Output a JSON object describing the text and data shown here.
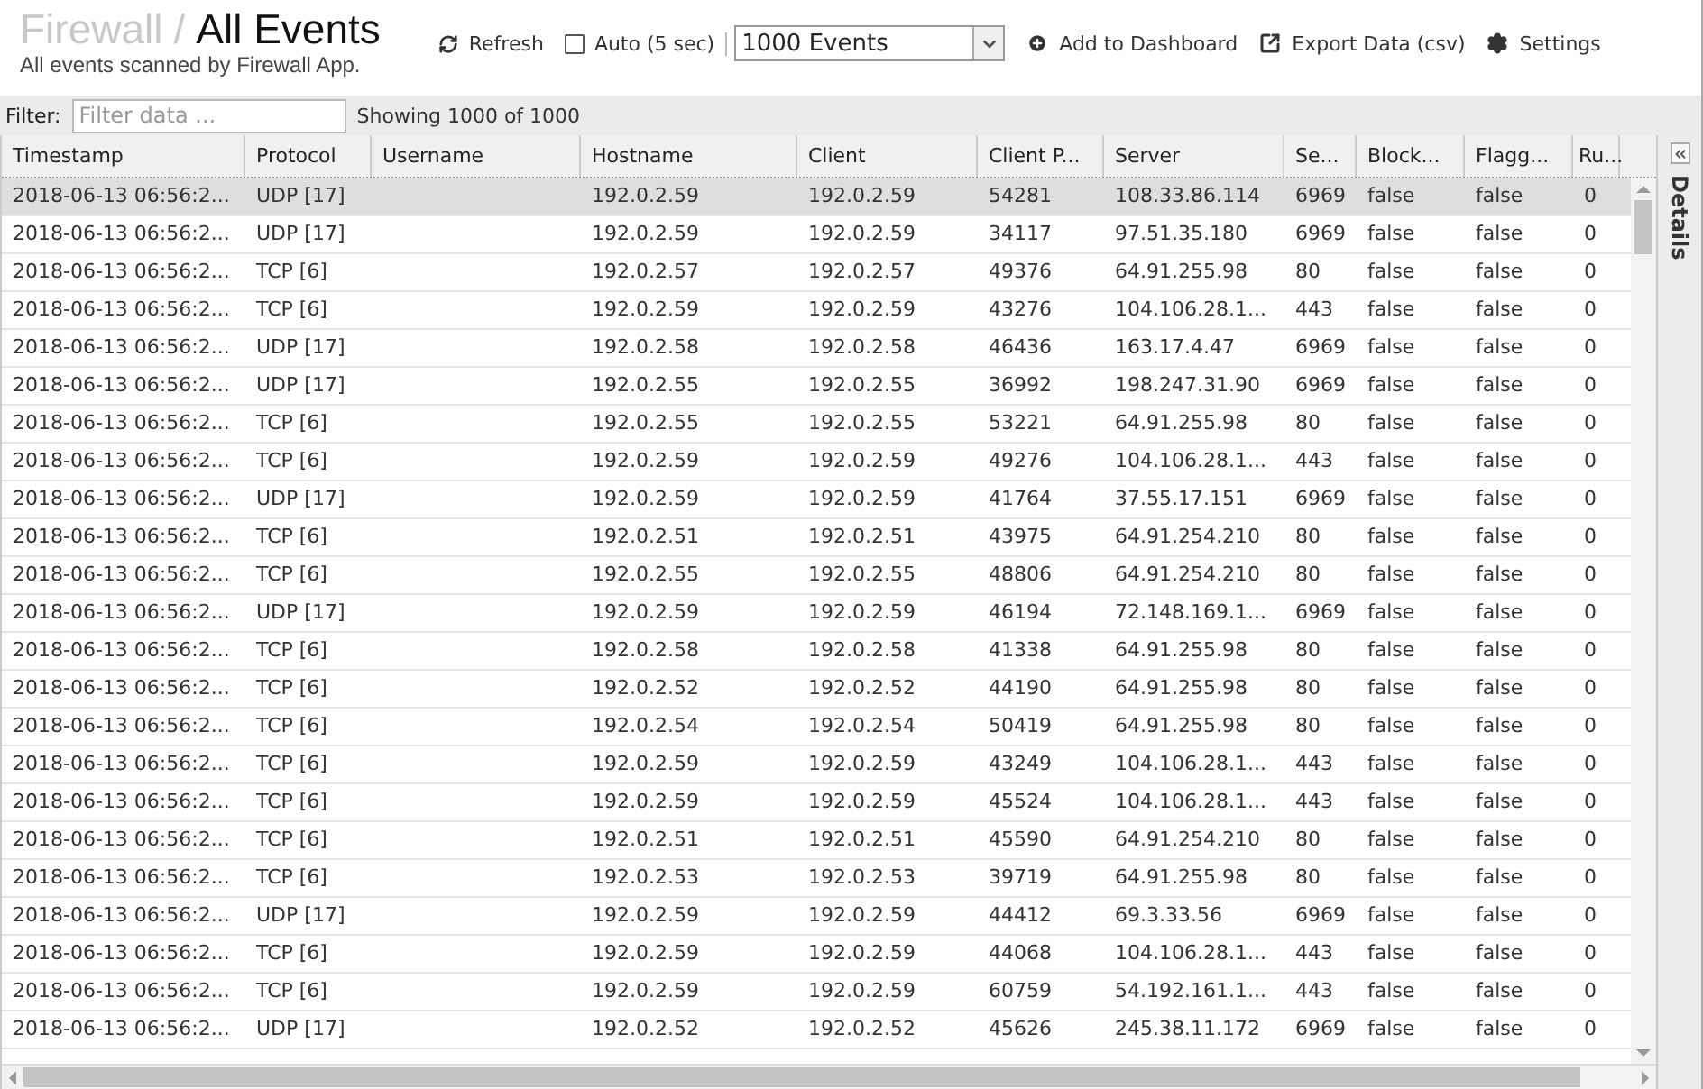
{
  "header": {
    "breadcrumb": "Firewall",
    "separator": "/",
    "title": "All Events",
    "subtitle": "All events scanned by Firewall App."
  },
  "toolbar": {
    "refresh": "Refresh",
    "auto": {
      "label": "Auto (5 sec)",
      "checked": false
    },
    "limit": "1000 Events",
    "add": "Add to Dashboard",
    "export": "Export Data (csv)",
    "settings": "Settings"
  },
  "filter": {
    "label": "Filter:",
    "placeholder": "Filter data ...",
    "count": "Showing 1000 of 1000"
  },
  "table": {
    "columns": [
      "Timestamp",
      "Protocol",
      "Username",
      "Hostname",
      "Client",
      "Client P...",
      "Server",
      "Se...",
      "Block...",
      "Flagg...",
      "Ru..."
    ],
    "rows": [
      {
        "selected": true,
        "cells": [
          "2018-06-13 06:56:2...",
          "UDP [17]",
          "",
          "192.0.2.59",
          "192.0.2.59",
          "54281",
          "108.33.86.114",
          "6969",
          "false",
          "false",
          "0"
        ]
      },
      {
        "selected": false,
        "cells": [
          "2018-06-13 06:56:2...",
          "UDP [17]",
          "",
          "192.0.2.59",
          "192.0.2.59",
          "34117",
          "97.51.35.180",
          "6969",
          "false",
          "false",
          "0"
        ]
      },
      {
        "selected": false,
        "cells": [
          "2018-06-13 06:56:2...",
          "TCP [6]",
          "",
          "192.0.2.57",
          "192.0.2.57",
          "49376",
          "64.91.255.98",
          "80",
          "false",
          "false",
          "0"
        ]
      },
      {
        "selected": false,
        "cells": [
          "2018-06-13 06:56:2...",
          "TCP [6]",
          "",
          "192.0.2.59",
          "192.0.2.59",
          "43276",
          "104.106.28.1...",
          "443",
          "false",
          "false",
          "0"
        ]
      },
      {
        "selected": false,
        "cells": [
          "2018-06-13 06:56:2...",
          "UDP [17]",
          "",
          "192.0.2.58",
          "192.0.2.58",
          "46436",
          "163.17.4.47",
          "6969",
          "false",
          "false",
          "0"
        ]
      },
      {
        "selected": false,
        "cells": [
          "2018-06-13 06:56:2...",
          "UDP [17]",
          "",
          "192.0.2.55",
          "192.0.2.55",
          "36992",
          "198.247.31.90",
          "6969",
          "false",
          "false",
          "0"
        ]
      },
      {
        "selected": false,
        "cells": [
          "2018-06-13 06:56:2...",
          "TCP [6]",
          "",
          "192.0.2.55",
          "192.0.2.55",
          "53221",
          "64.91.255.98",
          "80",
          "false",
          "false",
          "0"
        ]
      },
      {
        "selected": false,
        "cells": [
          "2018-06-13 06:56:2...",
          "TCP [6]",
          "",
          "192.0.2.59",
          "192.0.2.59",
          "49276",
          "104.106.28.1...",
          "443",
          "false",
          "false",
          "0"
        ]
      },
      {
        "selected": false,
        "cells": [
          "2018-06-13 06:56:2...",
          "UDP [17]",
          "",
          "192.0.2.59",
          "192.0.2.59",
          "41764",
          "37.55.17.151",
          "6969",
          "false",
          "false",
          "0"
        ]
      },
      {
        "selected": false,
        "cells": [
          "2018-06-13 06:56:2...",
          "TCP [6]",
          "",
          "192.0.2.51",
          "192.0.2.51",
          "43975",
          "64.91.254.210",
          "80",
          "false",
          "false",
          "0"
        ]
      },
      {
        "selected": false,
        "cells": [
          "2018-06-13 06:56:2...",
          "TCP [6]",
          "",
          "192.0.2.55",
          "192.0.2.55",
          "48806",
          "64.91.254.210",
          "80",
          "false",
          "false",
          "0"
        ]
      },
      {
        "selected": false,
        "cells": [
          "2018-06-13 06:56:2...",
          "UDP [17]",
          "",
          "192.0.2.59",
          "192.0.2.59",
          "46194",
          "72.148.169.1...",
          "6969",
          "false",
          "false",
          "0"
        ]
      },
      {
        "selected": false,
        "cells": [
          "2018-06-13 06:56:2...",
          "TCP [6]",
          "",
          "192.0.2.58",
          "192.0.2.58",
          "41338",
          "64.91.255.98",
          "80",
          "false",
          "false",
          "0"
        ]
      },
      {
        "selected": false,
        "cells": [
          "2018-06-13 06:56:2...",
          "TCP [6]",
          "",
          "192.0.2.52",
          "192.0.2.52",
          "44190",
          "64.91.255.98",
          "80",
          "false",
          "false",
          "0"
        ]
      },
      {
        "selected": false,
        "cells": [
          "2018-06-13 06:56:2...",
          "TCP [6]",
          "",
          "192.0.2.54",
          "192.0.2.54",
          "50419",
          "64.91.255.98",
          "80",
          "false",
          "false",
          "0"
        ]
      },
      {
        "selected": false,
        "cells": [
          "2018-06-13 06:56:2...",
          "TCP [6]",
          "",
          "192.0.2.59",
          "192.0.2.59",
          "43249",
          "104.106.28.1...",
          "443",
          "false",
          "false",
          "0"
        ]
      },
      {
        "selected": false,
        "cells": [
          "2018-06-13 06:56:2...",
          "TCP [6]",
          "",
          "192.0.2.59",
          "192.0.2.59",
          "45524",
          "104.106.28.1...",
          "443",
          "false",
          "false",
          "0"
        ]
      },
      {
        "selected": false,
        "cells": [
          "2018-06-13 06:56:2...",
          "TCP [6]",
          "",
          "192.0.2.51",
          "192.0.2.51",
          "45590",
          "64.91.254.210",
          "80",
          "false",
          "false",
          "0"
        ]
      },
      {
        "selected": false,
        "cells": [
          "2018-06-13 06:56:2...",
          "TCP [6]",
          "",
          "192.0.2.53",
          "192.0.2.53",
          "39719",
          "64.91.255.98",
          "80",
          "false",
          "false",
          "0"
        ]
      },
      {
        "selected": false,
        "cells": [
          "2018-06-13 06:56:2...",
          "UDP [17]",
          "",
          "192.0.2.59",
          "192.0.2.59",
          "44412",
          "69.3.33.56",
          "6969",
          "false",
          "false",
          "0"
        ]
      },
      {
        "selected": false,
        "cells": [
          "2018-06-13 06:56:2...",
          "TCP [6]",
          "",
          "192.0.2.59",
          "192.0.2.59",
          "44068",
          "104.106.28.1...",
          "443",
          "false",
          "false",
          "0"
        ]
      },
      {
        "selected": false,
        "cells": [
          "2018-06-13 06:56:2...",
          "TCP [6]",
          "",
          "192.0.2.59",
          "192.0.2.59",
          "60759",
          "54.192.161.1...",
          "443",
          "false",
          "false",
          "0"
        ]
      },
      {
        "selected": false,
        "cells": [
          "2018-06-13 06:56:2...",
          "UDP [17]",
          "",
          "192.0.2.52",
          "192.0.2.52",
          "45626",
          "245.38.11.172",
          "6969",
          "false",
          "false",
          "0"
        ]
      }
    ]
  },
  "details_tab": "Details"
}
